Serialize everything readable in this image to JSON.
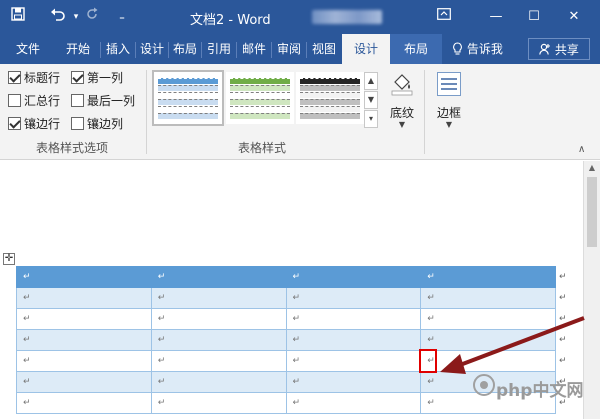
{
  "window": {
    "title": "文档2  -  Word",
    "ribbon_display_icon": "ribbon-display-options-icon",
    "minimize": "—",
    "maximize": "☐",
    "close": "✕"
  },
  "quick_access": {
    "save_icon": "save-icon",
    "undo_icon": "undo-icon",
    "redo_icon": "redo-icon",
    "customize_icon": "customize-caret-icon"
  },
  "tabs": [
    {
      "label": "文件"
    },
    {
      "label": "开始"
    },
    {
      "label": "插入"
    },
    {
      "label": "设计"
    },
    {
      "label": "布局"
    },
    {
      "label": "引用"
    },
    {
      "label": "邮件"
    },
    {
      "label": "审阅"
    },
    {
      "label": "视图"
    },
    {
      "label": "设计",
      "active": true
    },
    {
      "label": "布局",
      "contextual": true
    }
  ],
  "tell_me": "告诉我",
  "share": "共享",
  "table_style_options": {
    "group_label": "表格样式选项",
    "options": [
      {
        "label": "标题行",
        "checked": true
      },
      {
        "label": "第一列",
        "checked": true
      },
      {
        "label": "汇总行",
        "checked": false
      },
      {
        "label": "最后一列",
        "checked": false
      },
      {
        "label": "镶边行",
        "checked": true
      },
      {
        "label": "镶边列",
        "checked": false
      }
    ]
  },
  "table_styles": {
    "group_label": "表格样式",
    "swatch_colors": [
      "#5b9bd5",
      "#70ad47",
      "#262626"
    ],
    "selected_index": 0
  },
  "shading": {
    "label": "底纹"
  },
  "borders": {
    "label": "边框"
  },
  "document_table": {
    "rows": 7,
    "cols": 4,
    "header_color": "#5b9bd5",
    "band_color": "#ddebf7",
    "mark": "↵",
    "highlight_cell": {
      "row": 4,
      "col": 4
    }
  },
  "annotation": {
    "arrow_color": "#8b1a1a",
    "highlight_color": "#e00000"
  },
  "watermark": {
    "text": "php中文网"
  }
}
